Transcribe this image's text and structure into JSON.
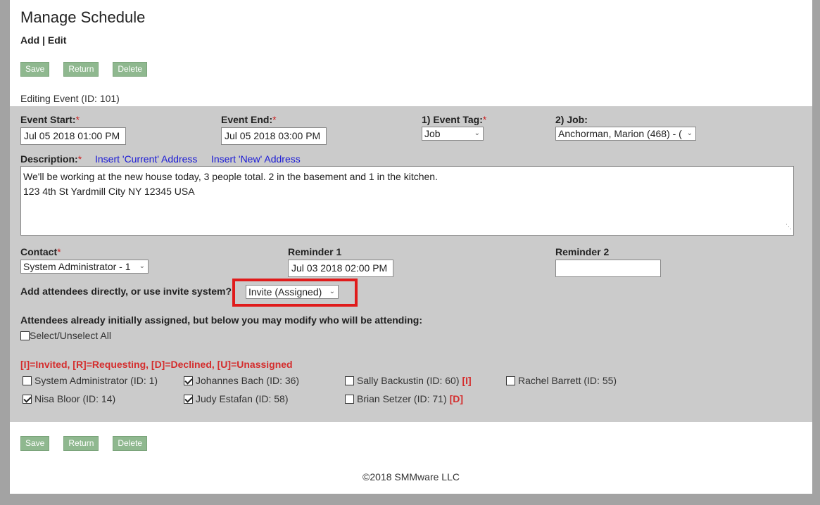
{
  "header": {
    "title": "Manage Schedule",
    "subnav": "Add | Edit"
  },
  "buttons": {
    "save": "Save",
    "return": "Return",
    "delete": "Delete"
  },
  "editing_label": "Editing Event (ID: 101)",
  "form": {
    "event_start": {
      "label": "Event Start:",
      "value": "Jul 05 2018 01:00 PM"
    },
    "event_end": {
      "label": "Event End:",
      "value": "Jul 05 2018 03:00 PM"
    },
    "event_tag": {
      "label": "1) Event Tag:",
      "value": "Job"
    },
    "job": {
      "label": "2) Job:",
      "value": "Anchorman, Marion (468) - ("
    },
    "description": {
      "label": "Description:",
      "link_current": "Insert 'Current' Address",
      "link_new": "Insert 'New' Address",
      "line1": "We'll be working at the new house today, 3 people total. 2 in the basement and 1 in the kitchen.",
      "line2": "123 4th St  Yardmill City NY 12345 USA"
    },
    "contact": {
      "label": "Contact",
      "value": "System Administrator - 1"
    },
    "reminder1": {
      "label": "Reminder 1",
      "value": "Jul 03 2018 02:00 PM"
    },
    "reminder2": {
      "label": "Reminder 2",
      "value": ""
    },
    "attendee_mode": {
      "label": "Add attendees directly, or use invite system?",
      "value": "Invite (Assigned)"
    },
    "required_mark": "*"
  },
  "attendees": {
    "heading": "Attendees already initially assigned, but below you may modify who will be attending:",
    "select_all": "Select/Unselect All",
    "legend": "[I]=Invited, [R]=Requesting, [D]=Declined, [U]=Unassigned",
    "list": [
      {
        "name": "System Administrator (ID: 1)",
        "checked": false,
        "tag": ""
      },
      {
        "name": "Johannes Bach (ID: 36)",
        "checked": true,
        "tag": ""
      },
      {
        "name": "Sally Backustin (ID: 60)",
        "checked": false,
        "tag": "[I]"
      },
      {
        "name": "Rachel Barrett (ID: 55)",
        "checked": false,
        "tag": ""
      },
      {
        "name": "Nisa Bloor (ID: 14)",
        "checked": true,
        "tag": ""
      },
      {
        "name": "Judy Estafan (ID: 58)",
        "checked": true,
        "tag": ""
      },
      {
        "name": "Brian Setzer (ID: 71)",
        "checked": false,
        "tag": "[D]"
      }
    ]
  },
  "footer": "©2018 SMMware LLC",
  "colors": {
    "button_bg": "#8fb88f",
    "panel_bg": "#cbcbcb",
    "highlight": "#e01b1b",
    "legend": "#d42d2d",
    "link": "#1a1ad6"
  }
}
